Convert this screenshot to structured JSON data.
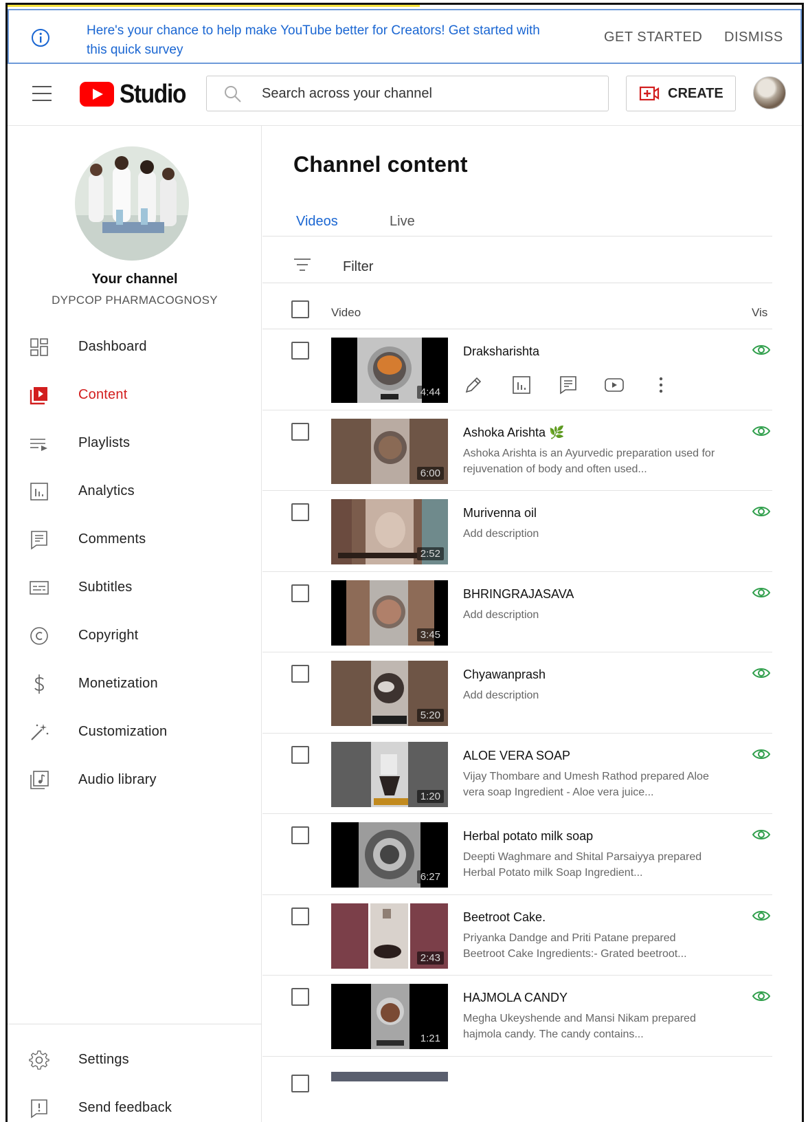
{
  "banner": {
    "message": "Here's your chance to help make YouTube better for Creators! Get started with this quick survey",
    "get_started": "GET STARTED",
    "dismiss": "DISMISS"
  },
  "topbar": {
    "logo_text": "Studio",
    "search_placeholder": "Search across your channel",
    "create_label": "CREATE"
  },
  "sidebar": {
    "channel_title": "Your channel",
    "channel_name": "DYPCOP PHARMACOGNOSY",
    "items": [
      {
        "label": "Dashboard",
        "icon": "dashboard-icon"
      },
      {
        "label": "Content",
        "icon": "content-icon",
        "active": true
      },
      {
        "label": "Playlists",
        "icon": "playlists-icon"
      },
      {
        "label": "Analytics",
        "icon": "analytics-icon"
      },
      {
        "label": "Comments",
        "icon": "comments-icon"
      },
      {
        "label": "Subtitles",
        "icon": "subtitles-icon"
      },
      {
        "label": "Copyright",
        "icon": "copyright-icon"
      },
      {
        "label": "Monetization",
        "icon": "monetization-icon"
      },
      {
        "label": "Customization",
        "icon": "customization-icon"
      },
      {
        "label": "Audio library",
        "icon": "audio-library-icon"
      }
    ],
    "bottom": [
      {
        "label": "Settings",
        "icon": "settings-icon"
      },
      {
        "label": "Send feedback",
        "icon": "feedback-icon"
      }
    ]
  },
  "main": {
    "title": "Channel content",
    "tabs": [
      {
        "label": "Videos",
        "active": true
      },
      {
        "label": "Live"
      }
    ],
    "filter_label": "Filter",
    "columns": {
      "video": "Video",
      "visibility": "Vis"
    },
    "videos": [
      {
        "title": "Draksharishta",
        "description": "",
        "duration": "4:44"
      },
      {
        "title": "Ashoka Arishta 🌿",
        "description": "Ashoka Arishta is an Ayurvedic preparation used for rejuvenation of body and often used...",
        "duration": "6:00"
      },
      {
        "title": "Murivenna oil",
        "description": "Add description",
        "duration": "2:52"
      },
      {
        "title": "BHRINGRAJASAVA",
        "description": "Add description",
        "duration": "3:45"
      },
      {
        "title": "Chyawanprash",
        "description": "Add description",
        "duration": "5:20"
      },
      {
        "title": "ALOE VERA SOAP",
        "description": "Vijay Thombare and Umesh Rathod prepared Aloe vera soap Ingredient - Aloe vera juice...",
        "duration": "1:20"
      },
      {
        "title": "Herbal potato milk soap",
        "description": "Deepti Waghmare and Shital Parsaiyya prepared Herbal Potato milk Soap Ingredient...",
        "duration": "6:27"
      },
      {
        "title": "Beetroot Cake.",
        "description": "Priyanka Dandge and Priti Patane prepared Beetroot Cake Ingredients:- Grated beetroot...",
        "duration": "2:43"
      },
      {
        "title": "HAJMOLA CANDY",
        "description": "Megha Ukeyshende and Mansi Nikam prepared hajmola candy. The candy contains...",
        "duration": "1:21"
      }
    ]
  },
  "colors": {
    "accent_blue": "#1a66d2",
    "brand_red": "#ff0000",
    "active_red": "#d21e1e",
    "visibility_green": "#2e9e4a"
  }
}
